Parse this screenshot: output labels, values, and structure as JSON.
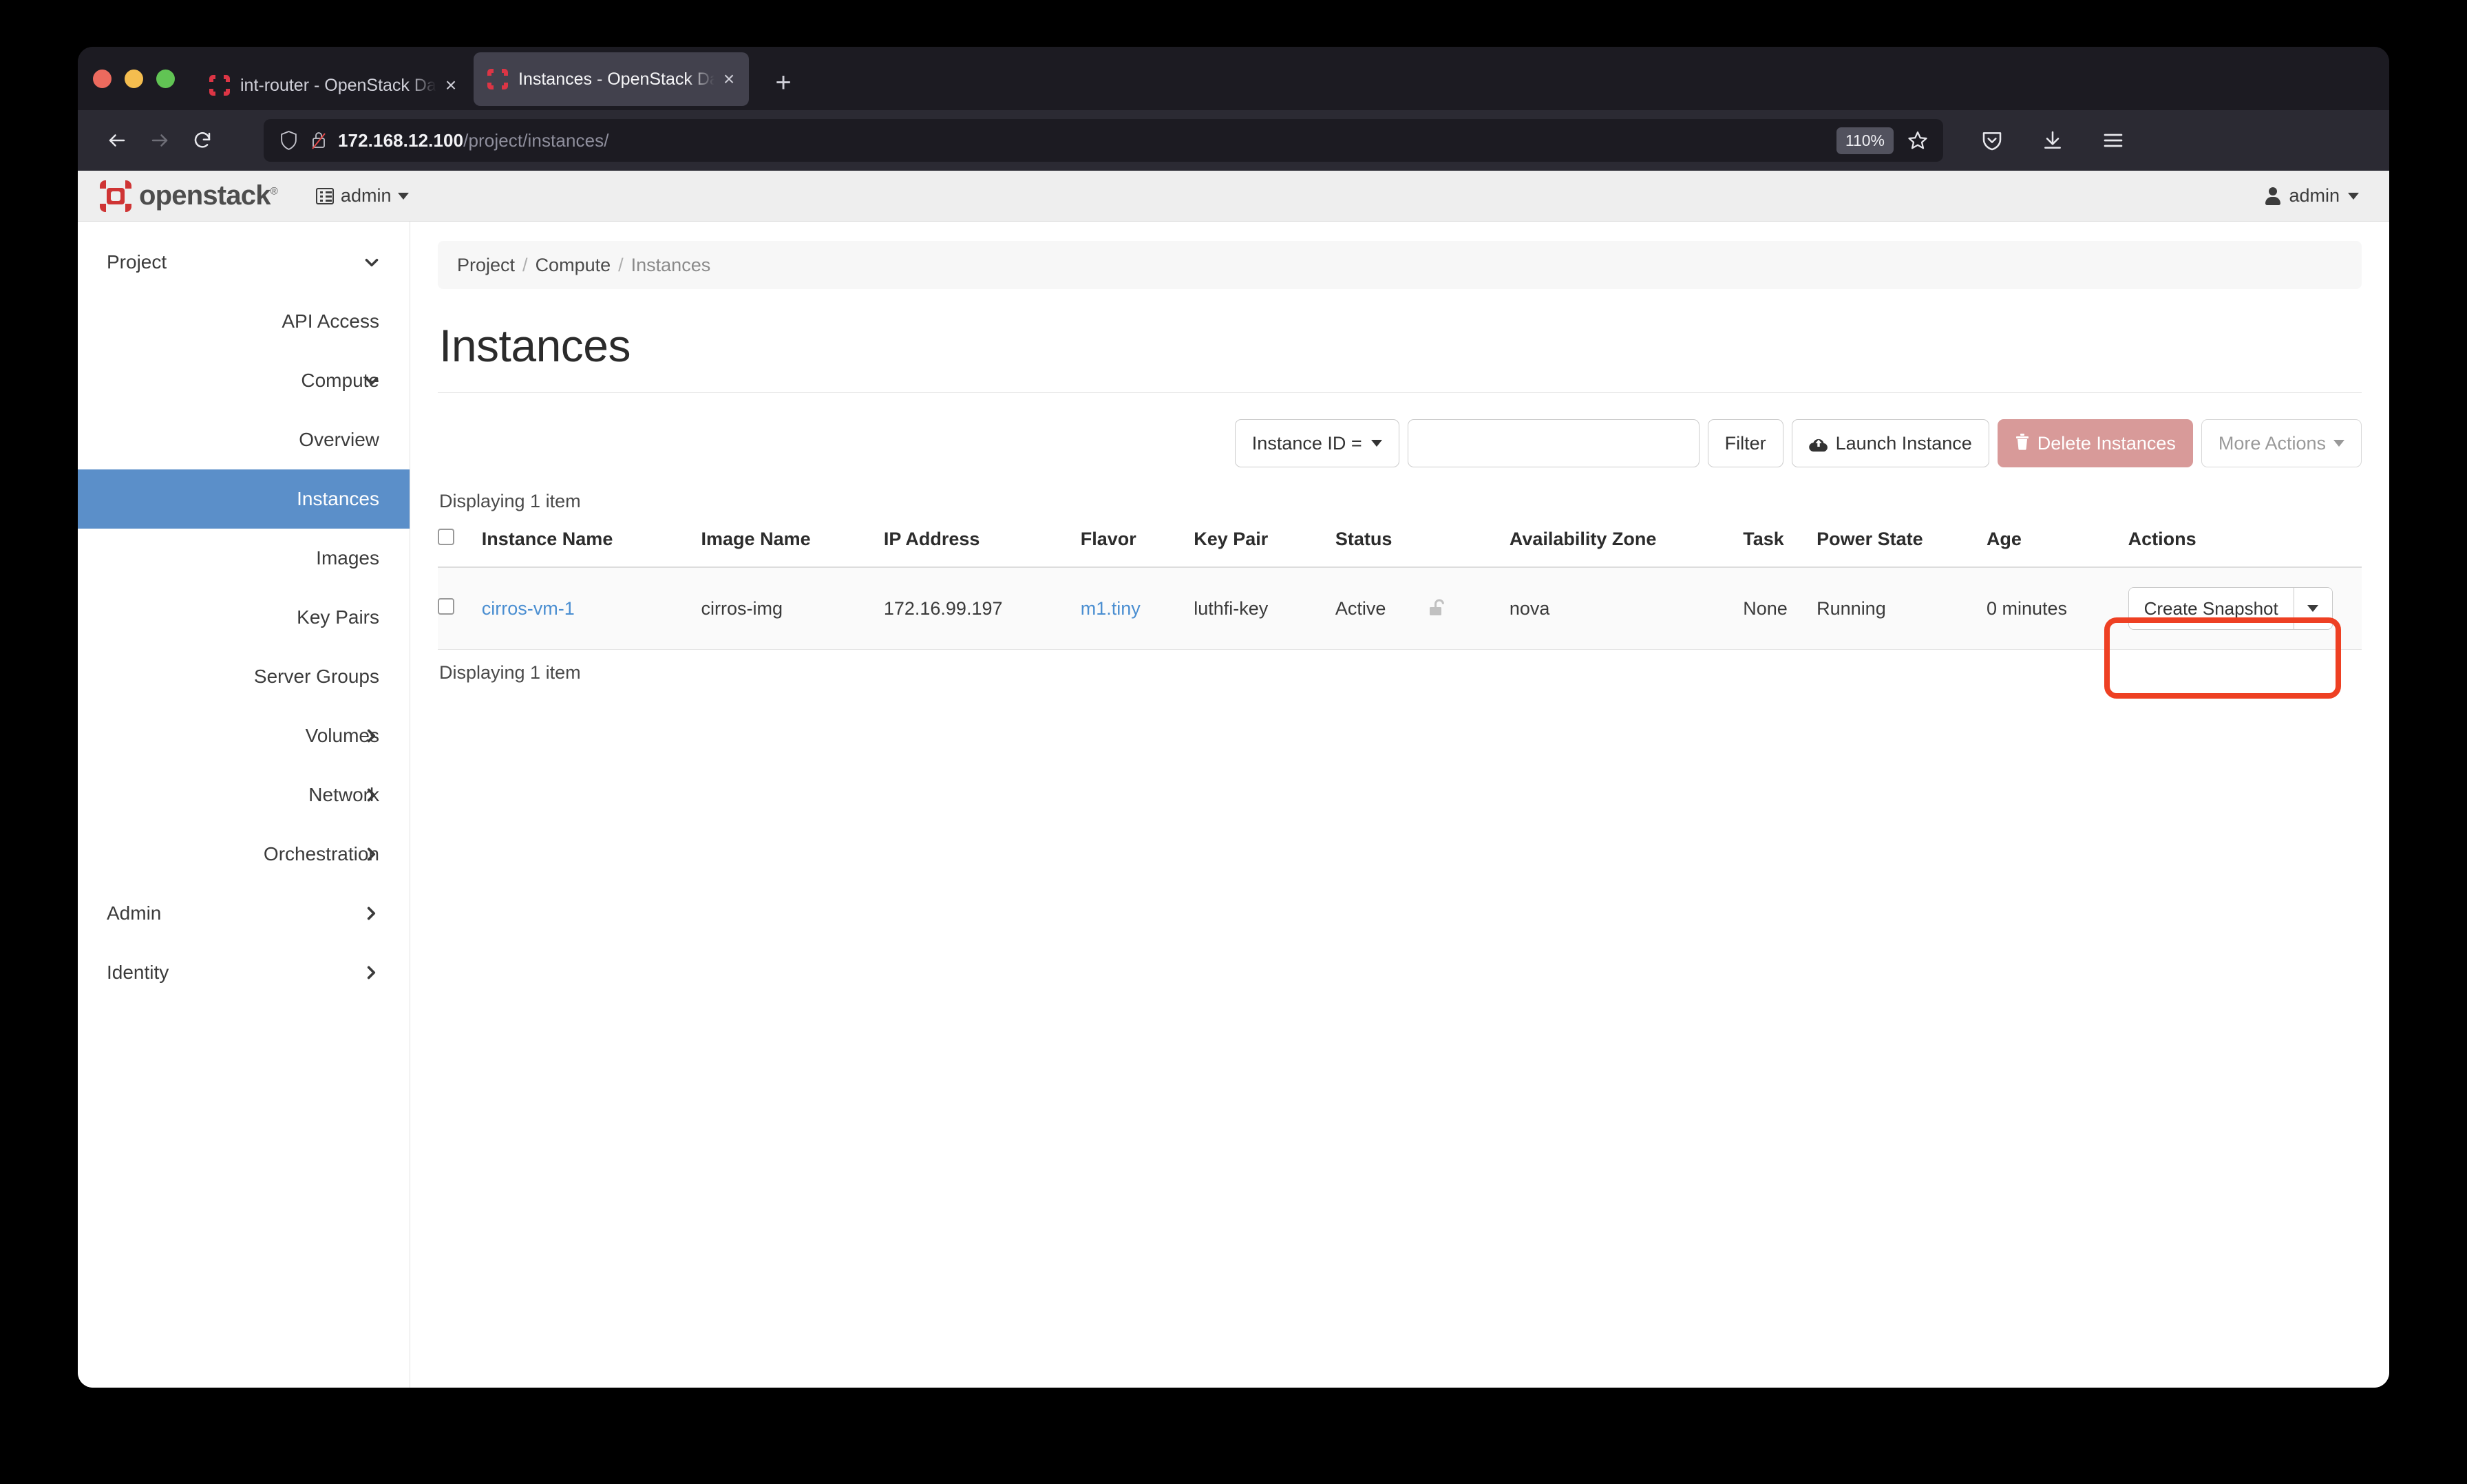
{
  "browser": {
    "tabs": [
      {
        "title": "int-router - OpenStack Dashboard",
        "favicon": "openstack-icon",
        "active": false,
        "close_label": "×"
      },
      {
        "title": "Instances - OpenStack Dashboard",
        "favicon": "openstack-icon",
        "active": true,
        "close_label": "×"
      }
    ],
    "new_tab_label": "+",
    "url_host": "172.168.12.100",
    "url_path": "/project/instances/",
    "zoom_level": "110%",
    "security": "insecure-http"
  },
  "header": {
    "logo_text": "openstack",
    "logo_reg_mark": "®",
    "project_label": "admin",
    "user_label": "admin"
  },
  "sidebar": {
    "items": [
      {
        "label": "Project",
        "level": 0,
        "chevron": "chevron-down",
        "active": false
      },
      {
        "label": "API Access",
        "level": 1,
        "chevron": "",
        "active": false
      },
      {
        "label": "Compute",
        "level": 1,
        "chevron": "chevron-down",
        "active": false
      },
      {
        "label": "Overview",
        "level": 2,
        "chevron": "",
        "active": false
      },
      {
        "label": "Instances",
        "level": 2,
        "chevron": "",
        "active": true
      },
      {
        "label": "Images",
        "level": 2,
        "chevron": "",
        "active": false
      },
      {
        "label": "Key Pairs",
        "level": 2,
        "chevron": "",
        "active": false
      },
      {
        "label": "Server Groups",
        "level": 2,
        "chevron": "",
        "active": false
      },
      {
        "label": "Volumes",
        "level": 1,
        "chevron": "chevron-right",
        "active": false
      },
      {
        "label": "Network",
        "level": 1,
        "chevron": "chevron-right",
        "active": false
      },
      {
        "label": "Orchestration",
        "level": 1,
        "chevron": "chevron-right",
        "active": false
      },
      {
        "label": "Admin",
        "level": 0,
        "chevron": "chevron-right",
        "active": false
      },
      {
        "label": "Identity",
        "level": 0,
        "chevron": "chevron-right",
        "active": false
      }
    ]
  },
  "main": {
    "breadcrumb": {
      "items": [
        "Project",
        "Compute",
        "Instances"
      ],
      "separator": "/"
    },
    "page_title": "Instances",
    "toolbar": {
      "filter_select_label": "Instance ID =",
      "filter_input_value": "",
      "filter_input_placeholder": "",
      "filter_button": "Filter",
      "launch_instance_button": "Launch Instance",
      "delete_instances_button": "Delete Instances",
      "more_actions_button": "More Actions"
    },
    "count_top": "Displaying 1 item",
    "count_bottom": "Displaying 1 item",
    "table": {
      "columns": [
        "",
        "Instance Name",
        "Image Name",
        "IP Address",
        "Flavor",
        "Key Pair",
        "Status",
        "Availability Zone",
        "Task",
        "Power State",
        "Age",
        "Actions"
      ],
      "rows": [
        {
          "instance_name": "cirros-vm-1",
          "image_name": "cirros-img",
          "ip_address": "172.16.99.197",
          "flavor": "m1.tiny",
          "key_pair": "luthfi-key",
          "status": "Active",
          "lock_state": "unlocked",
          "availability_zone": "nova",
          "task": "None",
          "power_state": "Running",
          "age": "0 minutes",
          "action_label": "Create Snapshot"
        }
      ]
    }
  },
  "colors": {
    "sidebar_active": "#5b8fc9",
    "link": "#4a8ed1",
    "delete_button": "#d89a99",
    "annotation_highlight": "#ee4023",
    "openstack_red": "#cf3434"
  }
}
